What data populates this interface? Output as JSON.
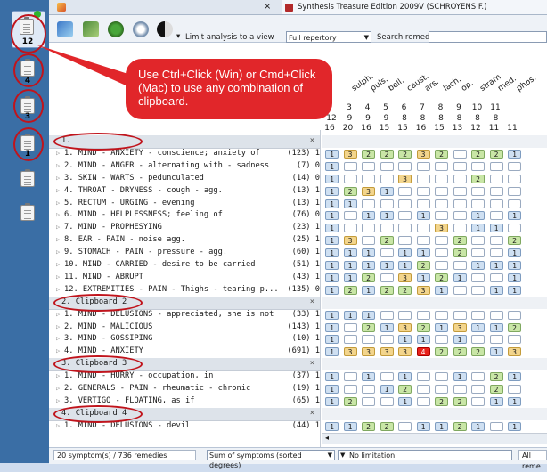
{
  "app": {
    "tab_title": "Synthesis Treasure Edition 2009V (SCHROYENS F.)",
    "tab_close": "×"
  },
  "toolbar": {
    "limit_label": "Limit analysis to a view",
    "limit_value": "Full repertory",
    "search_label": "Search remedy:",
    "search_value": ""
  },
  "callout": {
    "text": "Use Ctrl+Click (Win) or Cmd+Click (Mac) to use any combination of clipboard."
  },
  "clipboards": [
    {
      "label": "12"
    },
    {
      "label": "4"
    },
    {
      "label": "3"
    },
    {
      "label": "1"
    },
    {
      "label": ""
    },
    {
      "label": ""
    }
  ],
  "remedies": [
    "sulph.",
    "puls.",
    "bell.",
    "caust.",
    "ars.",
    "lach.",
    "op.",
    "stram.",
    "med.",
    "phos."
  ],
  "header_numbers": {
    "row1": [
      "3",
      "4",
      "5",
      "6",
      "7",
      "8",
      "9",
      "10",
      "11"
    ],
    "row2": [
      "12",
      "9",
      "9",
      "9",
      "8",
      "8",
      "8",
      "8",
      "8",
      "8"
    ],
    "row3": [
      "16",
      "20",
      "16",
      "15",
      "15",
      "16",
      "15",
      "13",
      "12",
      "11",
      "11"
    ]
  },
  "groups": [
    {
      "title": "1.",
      "close": "×",
      "rows": [
        {
          "text": "1. MIND - ANXIETY - conscience; anxiety of",
          "count": "(123) 1",
          "cells": [
            1,
            3,
            2,
            2,
            2,
            3,
            2,
            0,
            2,
            2,
            1
          ]
        },
        {
          "text": "2. MIND - ANGER - alternating with - sadness",
          "count": "(7) 0",
          "cells": [
            1,
            0,
            0,
            0,
            0,
            0,
            0,
            0,
            0,
            0,
            0
          ]
        },
        {
          "text": "3. SKIN - WARTS - pedunculated",
          "count": "(14) 0",
          "cells": [
            1,
            0,
            0,
            0,
            3,
            0,
            0,
            0,
            2,
            0,
            0
          ]
        },
        {
          "text": "4. THROAT - DRYNESS - cough - agg.",
          "count": "(13) 1",
          "cells": [
            1,
            2,
            3,
            1,
            0,
            0,
            0,
            0,
            0,
            0,
            0
          ]
        },
        {
          "text": "5. RECTUM - URGING - evening",
          "count": "(13) 1",
          "cells": [
            1,
            1,
            0,
            0,
            0,
            0,
            0,
            0,
            0,
            0,
            0
          ]
        },
        {
          "text": "6. MIND - HELPLESSNESS; feeling of",
          "count": "(76) 0",
          "cells": [
            1,
            0,
            1,
            1,
            0,
            1,
            0,
            0,
            1,
            0,
            1
          ]
        },
        {
          "text": "7. MIND - PROPHESYING",
          "count": "(23) 1",
          "cells": [
            1,
            0,
            0,
            0,
            0,
            0,
            3,
            0,
            1,
            1,
            0
          ]
        },
        {
          "text": "8. EAR - PAIN - noise agg.",
          "count": "(25) 1",
          "cells": [
            1,
            3,
            0,
            2,
            0,
            0,
            0,
            2,
            0,
            0,
            2
          ]
        },
        {
          "text": "9. STOMACH - PAIN - pressure - agg.",
          "count": "(60) 1",
          "cells": [
            1,
            1,
            1,
            0,
            1,
            1,
            0,
            2,
            0,
            0,
            1
          ]
        },
        {
          "text": "10. MIND - CARRIED - desire to be carried",
          "count": "(51) 1",
          "cells": [
            1,
            1,
            1,
            1,
            1,
            2,
            0,
            0,
            1,
            1,
            1
          ]
        },
        {
          "text": "11. MIND - ABRUPT",
          "count": "(43) 1",
          "cells": [
            1,
            1,
            2,
            0,
            3,
            1,
            2,
            1,
            0,
            0,
            1
          ]
        },
        {
          "text": "12. EXTREMITIES - PAIN - Thighs - tearing p...",
          "count": "(135) 0",
          "cells": [
            1,
            2,
            1,
            2,
            2,
            3,
            1,
            0,
            0,
            1,
            1
          ]
        }
      ]
    },
    {
      "title": "2. Clipboard 2",
      "close": "×",
      "rows": [
        {
          "text": "1. MIND - DELUSIONS - appreciated, she is not",
          "count": "(33) 1",
          "cells": [
            1,
            1,
            1,
            0,
            0,
            0,
            0,
            0,
            0,
            0,
            0
          ]
        },
        {
          "text": "2. MIND - MALICIOUS",
          "count": "(143) 1",
          "cells": [
            1,
            0,
            2,
            1,
            3,
            2,
            1,
            3,
            1,
            1,
            2
          ]
        },
        {
          "text": "3. MIND - GOSSIPING",
          "count": "(10) 1",
          "cells": [
            1,
            0,
            0,
            0,
            1,
            1,
            0,
            1,
            0,
            0,
            0
          ]
        },
        {
          "text": "4. MIND - ANXIETY",
          "count": "(691) 1",
          "cells": [
            1,
            3,
            3,
            3,
            3,
            4,
            2,
            2,
            2,
            1,
            3
          ]
        }
      ]
    },
    {
      "title": "3. Clipboard 3",
      "close": "×",
      "rows": [
        {
          "text": "1. MIND - HURRY - occupation, in",
          "count": "(37) 1",
          "cells": [
            1,
            0,
            1,
            0,
            1,
            0,
            0,
            1,
            0,
            2,
            1
          ]
        },
        {
          "text": "2. GENERALS - PAIN - rheumatic - chronic",
          "count": "(19) 1",
          "cells": [
            1,
            0,
            0,
            1,
            2,
            0,
            0,
            0,
            0,
            2,
            0
          ]
        },
        {
          "text": "3. VERTIGO - FLOATING, as if",
          "count": "(65) 1",
          "cells": [
            1,
            2,
            0,
            0,
            1,
            0,
            2,
            2,
            0,
            1,
            1
          ]
        }
      ]
    },
    {
      "title": "4. Clipboard 4",
      "close": "×",
      "rows": [
        {
          "text": "1. MIND - DELUSIONS - devil",
          "count": "(44) 1",
          "cells": [
            1,
            1,
            2,
            2,
            0,
            1,
            1,
            2,
            1,
            0,
            1
          ]
        }
      ]
    }
  ],
  "status": {
    "summary": "20 symptom(s) / 736 remedies",
    "sort": "Sum of symptoms (sorted degrees)",
    "limitation": "No limitation",
    "right": "All reme"
  },
  "colors": {
    "accent_red": "#e1262a",
    "grade1": "#cfe0f2",
    "grade2": "#c9e6a6",
    "grade3": "#f3d58c",
    "grade4": "#e8221c"
  }
}
